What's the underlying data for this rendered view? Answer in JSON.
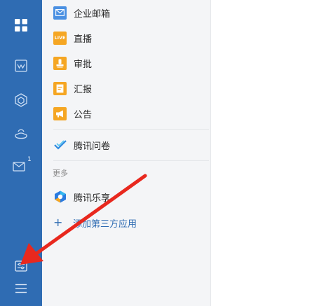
{
  "sidebar": {
    "background": "#2f6cb3",
    "icons": [
      {
        "name": "apps-grid-icon"
      },
      {
        "name": "doc-icon"
      },
      {
        "name": "cube-icon"
      },
      {
        "name": "phone-icon"
      },
      {
        "name": "mail-icon",
        "badge": "1"
      },
      {
        "name": "settings-panel-icon"
      },
      {
        "name": "menu-icon"
      }
    ]
  },
  "apps": {
    "items": [
      {
        "label": "企业邮箱",
        "icon": "mail-icon",
        "color": "#4a90e2"
      },
      {
        "label": "直播",
        "icon": "live-icon",
        "color": "#f5a623",
        "icon_text": "LIVE"
      },
      {
        "label": "审批",
        "icon": "approval-stamp-icon",
        "color": "#f5a623"
      },
      {
        "label": "汇报",
        "icon": "report-icon",
        "color": "#f5a623"
      },
      {
        "label": "公告",
        "icon": "megaphone-icon",
        "color": "#f5a623"
      }
    ],
    "survey": {
      "label": "腾讯问卷",
      "icon": "check-icon"
    },
    "more_title": "更多",
    "more_items": [
      {
        "label": "腾讯乐享",
        "icon": "lexiang-icon"
      }
    ],
    "add_link": {
      "label": "添加第三方应用",
      "icon": "plus-icon"
    }
  },
  "annotation": {
    "color": "#e8281e"
  }
}
